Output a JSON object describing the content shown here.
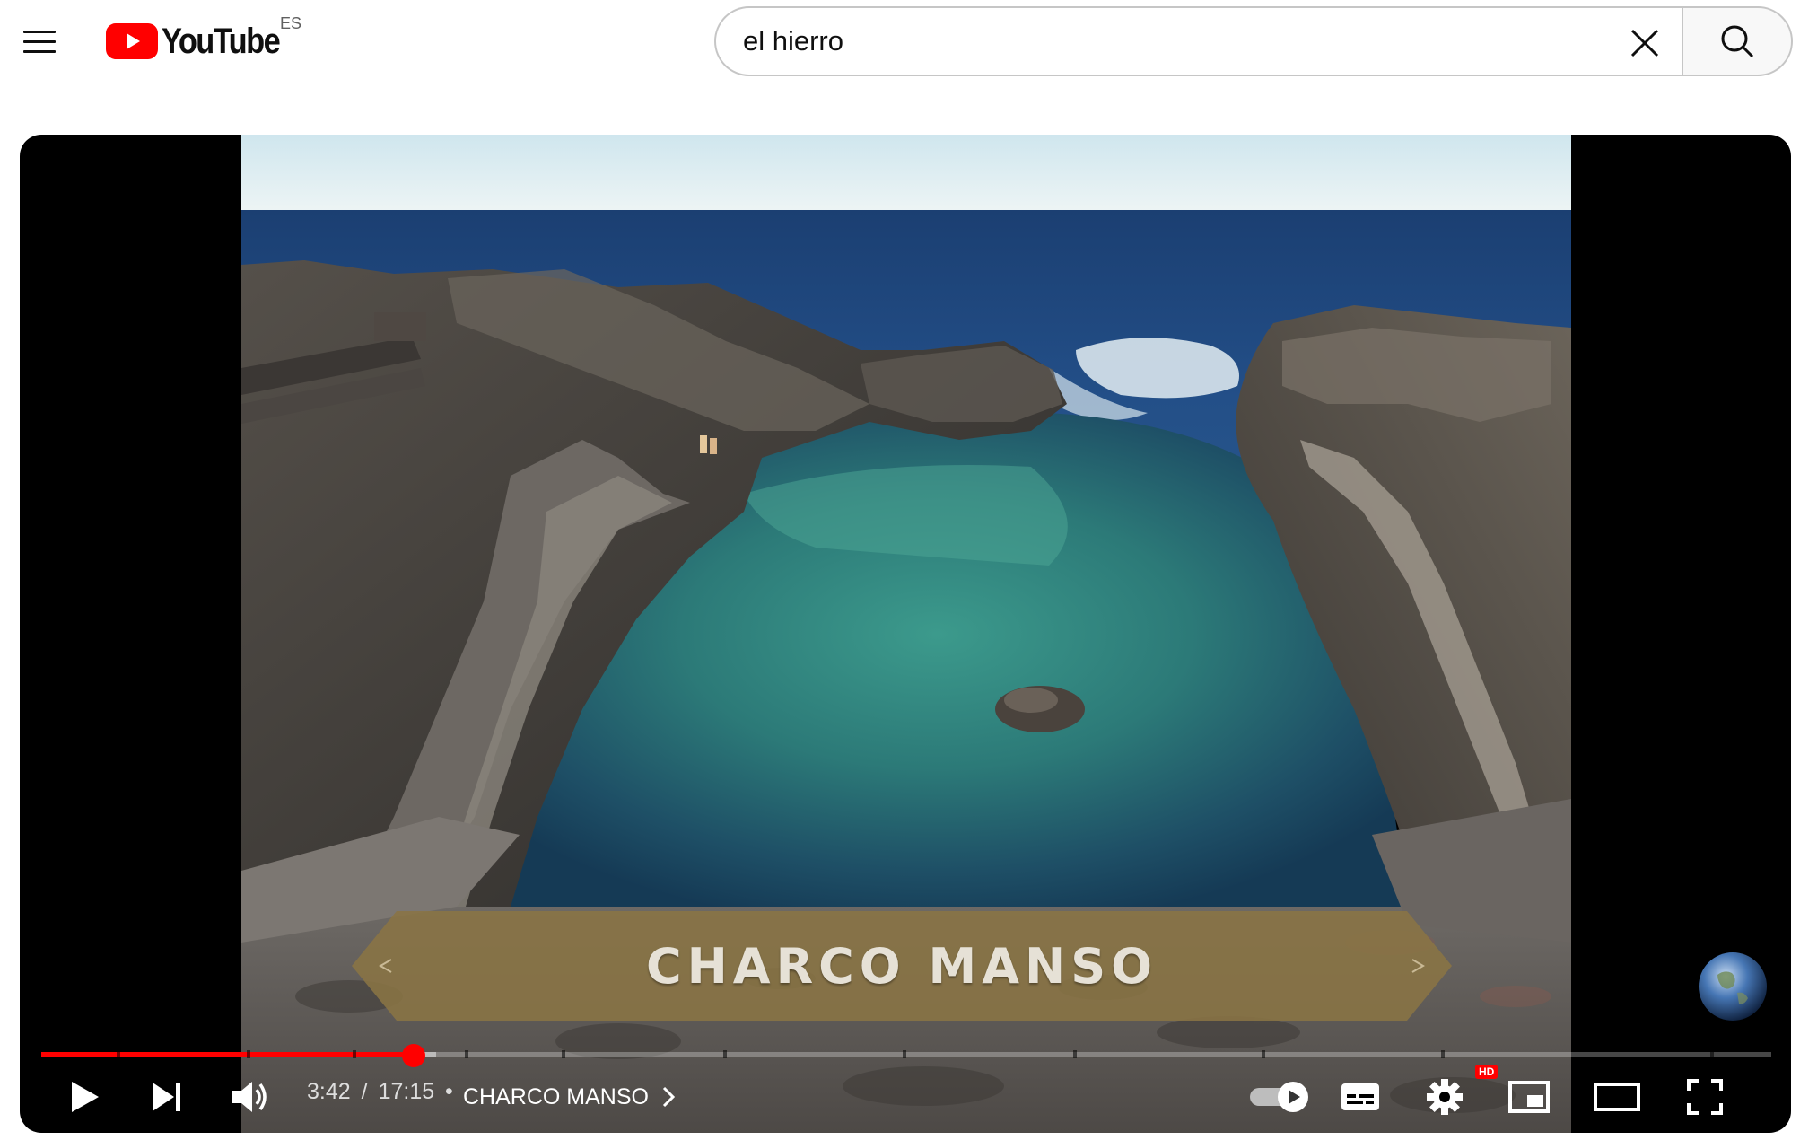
{
  "header": {
    "logo_text": "YouTube",
    "country_code": "ES",
    "search": {
      "value": "el hierro",
      "placeholder": "Search"
    }
  },
  "player": {
    "video_title_overlay": "CHARCO MANSO",
    "time": {
      "current": "3:42",
      "separator": "/",
      "total": "17:15"
    },
    "chapter_title": "CHARCO MANSO",
    "progress": {
      "played_fraction": 0.215,
      "buffered_fraction": 0.228
    },
    "quality_badge": "HD",
    "autoplay_on": true
  },
  "colors": {
    "accent": "#ff0000",
    "banner_gold": "#8a7444",
    "ocean": "#1f4a80",
    "lagoon": "#2e7f78"
  }
}
